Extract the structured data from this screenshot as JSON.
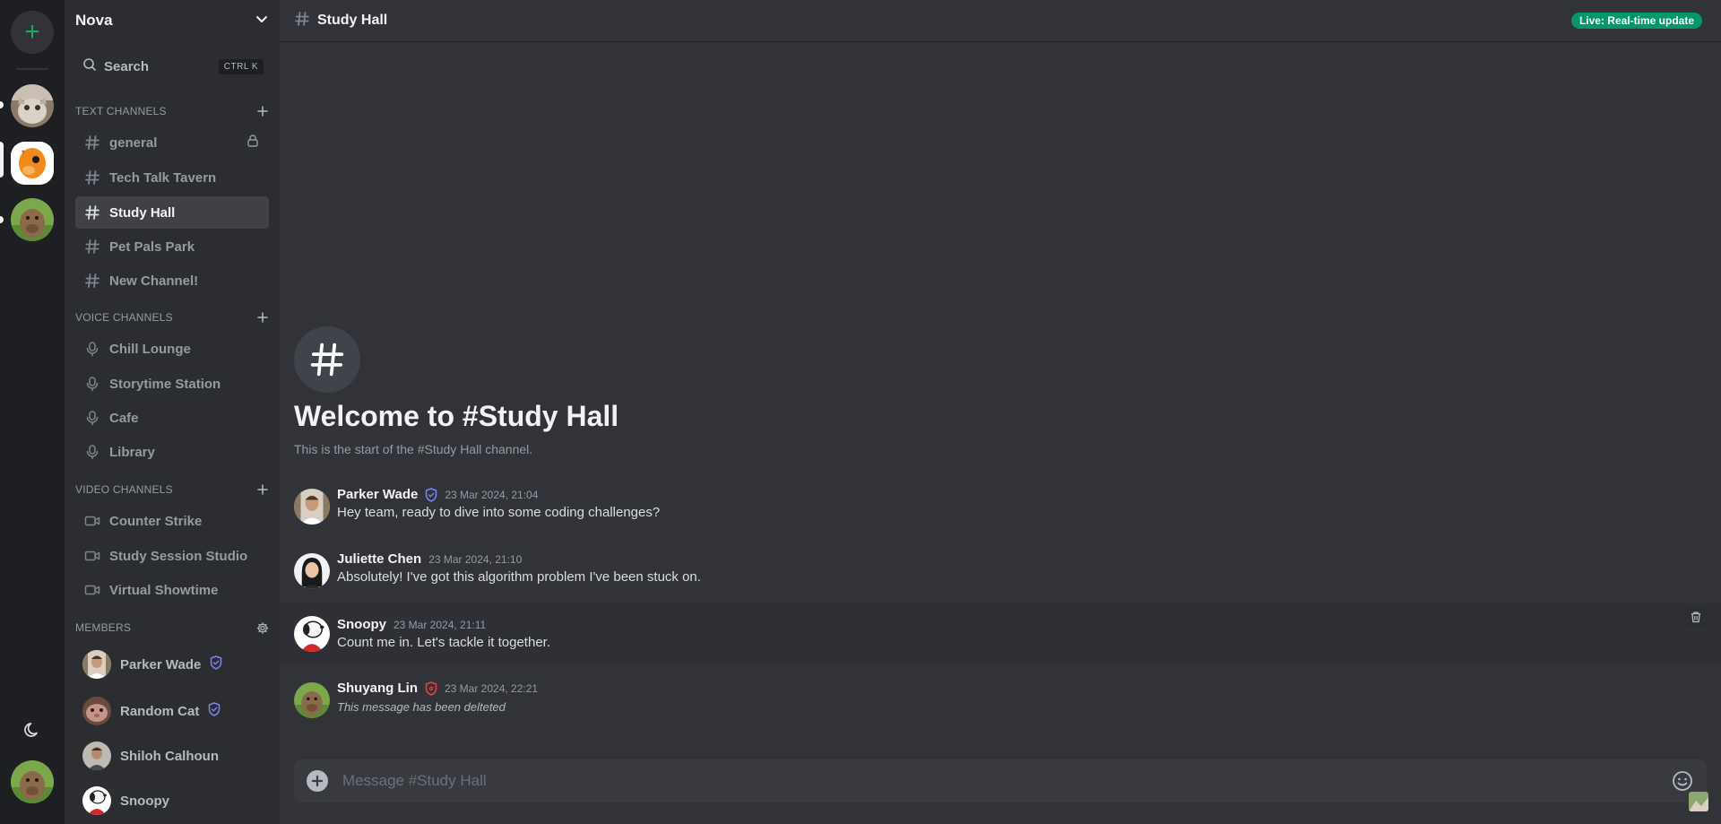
{
  "server": {
    "name": "Nova",
    "search_label": "Search",
    "search_shortcut": "CTRL K"
  },
  "rail": {
    "add_server_symbol": "+"
  },
  "sections": {
    "text": "TEXT CHANNELS",
    "voice": "VOICE CHANNELS",
    "video": "VIDEO CHANNELS",
    "members": "MEMBERS"
  },
  "text_channels": [
    {
      "label": "general",
      "icon": "hash-icon",
      "locked": true
    },
    {
      "label": "Tech Talk Tavern",
      "icon": "hash-icon"
    },
    {
      "label": "Study Hall",
      "icon": "hash-icon",
      "active": true
    },
    {
      "label": "Pet Pals Park",
      "icon": "hash-icon"
    },
    {
      "label": "New Channel!",
      "icon": "hash-icon"
    }
  ],
  "voice_channels": [
    {
      "label": "Chill Lounge",
      "icon": "microphone-icon"
    },
    {
      "label": "Storytime Station",
      "icon": "microphone-icon"
    },
    {
      "label": "Cafe",
      "icon": "microphone-icon"
    },
    {
      "label": "Library",
      "icon": "microphone-icon"
    }
  ],
  "video_channels": [
    {
      "label": "Counter Strike",
      "icon": "video-icon"
    },
    {
      "label": "Study Session Studio",
      "icon": "video-icon"
    },
    {
      "label": "Virtual Showtime",
      "icon": "video-icon"
    }
  ],
  "members": [
    {
      "name": "Parker Wade",
      "badge": "moderator-shield-icon"
    },
    {
      "name": "Random Cat",
      "badge": "moderator-shield-icon"
    },
    {
      "name": "Shiloh Calhoun"
    },
    {
      "name": "Snoopy"
    }
  ],
  "channel": {
    "title": "Study Hall",
    "live_badge": "Live: Real-time update",
    "welcome_title": "Welcome to #Study Hall",
    "welcome_sub": "This is the start of the #Study Hall channel."
  },
  "messages": [
    {
      "author": "Parker Wade",
      "badge": "moderator-shield-icon",
      "time": "23 Mar 2024, 21:04",
      "text": "Hey team, ready to dive into some coding challenges?"
    },
    {
      "author": "Juliette Chen",
      "time": "23 Mar 2024, 21:10",
      "text": "Absolutely! I've got this algorithm problem I've been stuck on."
    },
    {
      "author": "Snoopy",
      "time": "23 Mar 2024, 21:11",
      "text": "Count me in. Let's tackle it together."
    },
    {
      "author": "Shuyang Lin",
      "badge": "admin-shield-icon",
      "time": "23 Mar 2024, 22:21",
      "text": "This message has been delteted",
      "deleted": true
    }
  ],
  "composer": {
    "placeholder": "Message #Study Hall"
  },
  "colors": {
    "accent_live": "#059669",
    "moderator_badge": "#7b85f5",
    "admin_badge": "#f23f43",
    "add_server_green": "#23a55a"
  }
}
